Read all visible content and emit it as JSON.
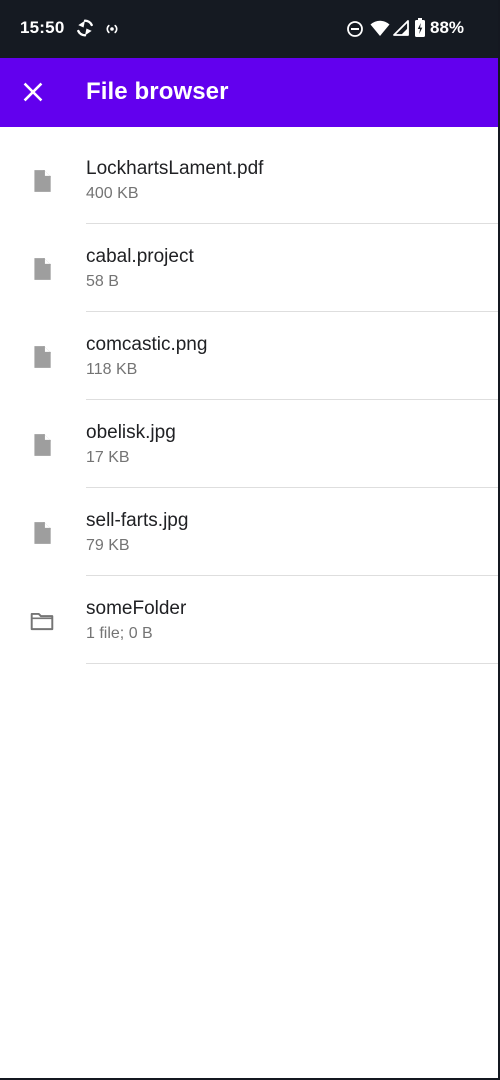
{
  "status_bar": {
    "time": "15:50",
    "battery": "88%",
    "icons": [
      "sync-icon",
      "hotspot-icon",
      "do-not-disturb-icon",
      "wifi-icon",
      "signal-icon",
      "battery-icon"
    ]
  },
  "app_bar": {
    "title": "File browser",
    "close_icon": "close-icon"
  },
  "files": [
    {
      "name": "LockhartsLament.pdf",
      "meta": "400 KB",
      "icon": "file-icon"
    },
    {
      "name": "cabal.project",
      "meta": "58 B",
      "icon": "file-icon"
    },
    {
      "name": "comcastic.png",
      "meta": "118 KB",
      "icon": "file-icon"
    },
    {
      "name": "obelisk.jpg",
      "meta": "17 KB",
      "icon": "file-icon"
    },
    {
      "name": "sell-farts.jpg",
      "meta": "79 KB",
      "icon": "file-icon"
    },
    {
      "name": "someFolder",
      "meta": "1 file; 0 B",
      "icon": "folder-icon"
    }
  ],
  "colors": {
    "status_bar": "#151a22",
    "app_bar": "#6200ee",
    "background": "#ffffff",
    "primary_text": "#202124",
    "secondary_text": "#747474",
    "icon": "#9e9e9e",
    "divider": "#dedede"
  }
}
